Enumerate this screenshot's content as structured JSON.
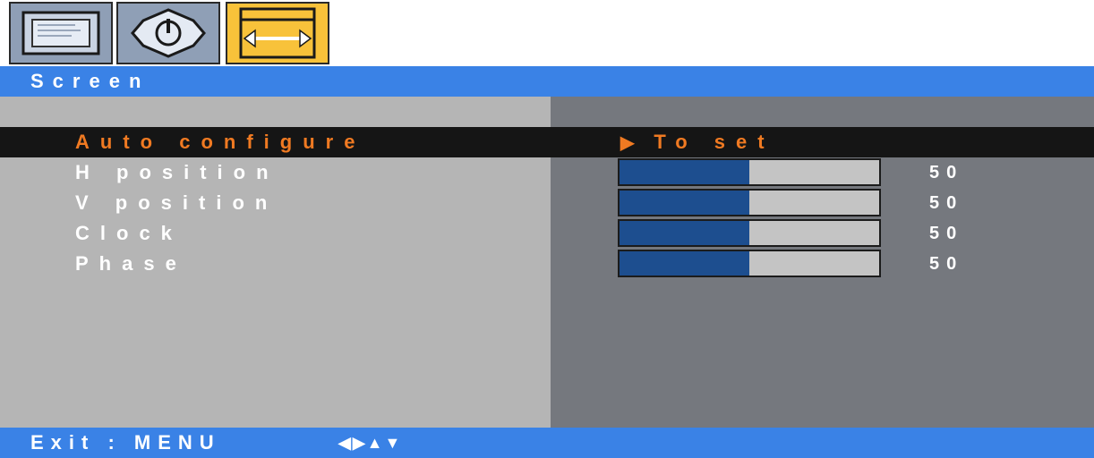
{
  "tabs": [
    {
      "icon": "monitor-icon",
      "active": false
    },
    {
      "icon": "power-settings-icon",
      "active": false
    },
    {
      "icon": "screen-resize-icon",
      "active": true
    }
  ],
  "title": "Screen",
  "menu": {
    "auto_configure": {
      "label": "Auto configure",
      "action_arrow": "▶",
      "action": "To set"
    },
    "h_position": {
      "label": "H position",
      "value": "50",
      "level": 0.5
    },
    "v_position": {
      "label": "V position",
      "value": "50",
      "level": 0.5
    },
    "clock": {
      "label": "Clock",
      "value": "50",
      "level": 0.5
    },
    "phase": {
      "label": "Phase",
      "value": "50",
      "level": 0.5
    }
  },
  "footer": {
    "exit": "Exit : MENU",
    "nav": "◀▶▲▼"
  },
  "colors": {
    "accent_blue": "#3a82e6",
    "selected_text": "#f07a22",
    "active_tab": "#f8c23a",
    "slider_fill": "#1d4e8f"
  }
}
